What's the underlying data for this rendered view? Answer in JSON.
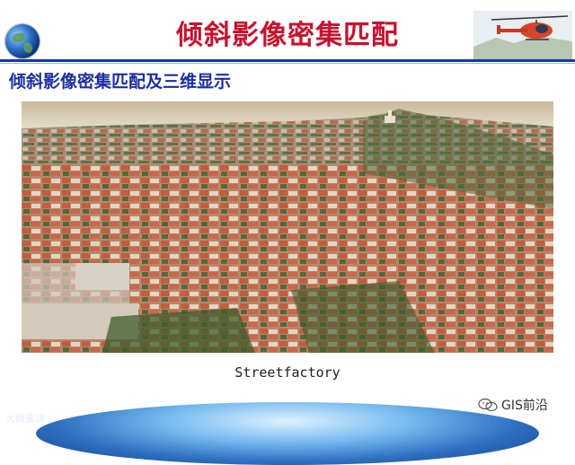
{
  "slide": {
    "title": "倾斜影像密集匹配",
    "subtitle": "倾斜影像密集匹配及三维显示",
    "caption": "Streetfactory"
  },
  "watermarks": {
    "left_text": "大融寰球",
    "right_text": "GIS前沿",
    "right_icon": "wechat-icon"
  },
  "colors": {
    "title": "#c8102e",
    "subtitle": "#1c2fa0",
    "rule": "#0b3aa8"
  }
}
